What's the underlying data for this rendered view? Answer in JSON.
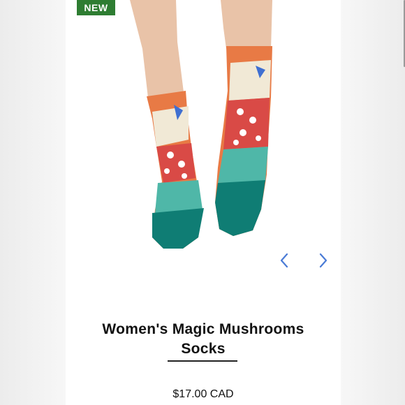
{
  "badge": {
    "label": "NEW",
    "color": "#2e7d32"
  },
  "carousel": {
    "prev_icon": "chevron-left-icon",
    "next_icon": "chevron-right-icon",
    "arrow_color": "#4a7bd6"
  },
  "product": {
    "title": "Women's Magic Mushrooms Socks",
    "price": "$17.00 CAD"
  }
}
